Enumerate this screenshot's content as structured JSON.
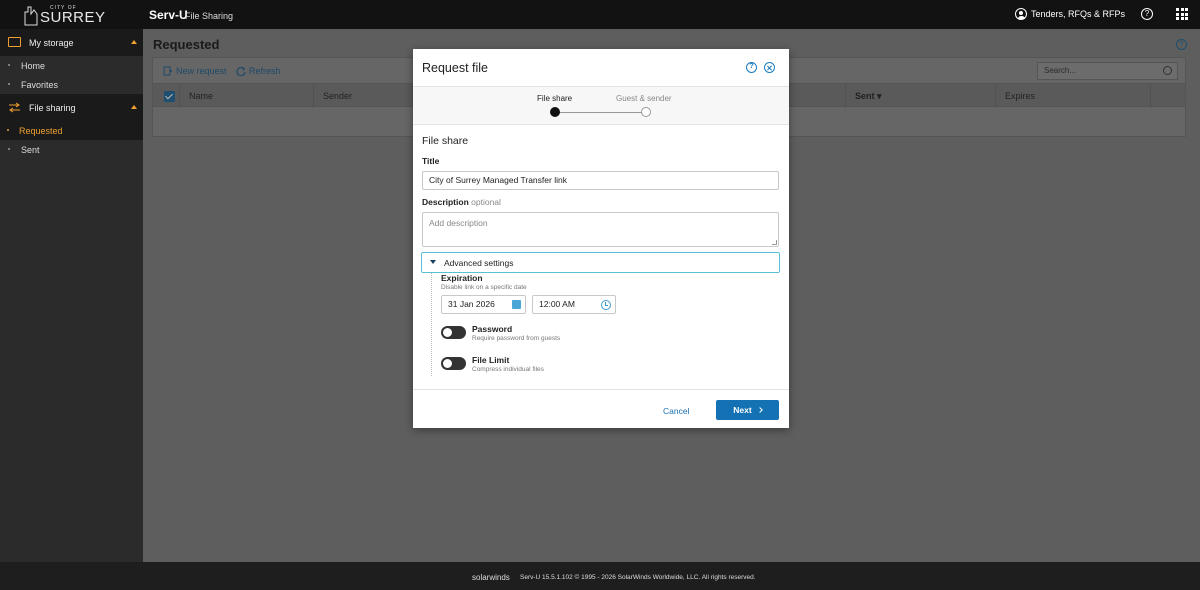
{
  "header": {
    "logo_small": "CITY OF",
    "logo_name": "SURREY",
    "app_title": "Serv-U",
    "app_subtitle": "File Sharing",
    "account_link": "Tenders, RFQs & RFPs"
  },
  "sidebar": {
    "sections": [
      {
        "label": "My storage",
        "items": [
          "Home",
          "Favorites"
        ]
      },
      {
        "label": "File sharing",
        "items": [
          "Requested",
          "Sent"
        ]
      }
    ],
    "active_item": "Requested",
    "accent_color": "#f0a030"
  },
  "main": {
    "title": "Requested",
    "toolbar": {
      "new_request": "New request",
      "refresh": "Refresh"
    },
    "search_placeholder": "Search...",
    "columns": [
      "Name",
      "Sender",
      "Sent",
      "Expires"
    ],
    "sort_indicator": "▾"
  },
  "modal": {
    "title": "Request file",
    "steps": [
      "File share",
      "Guest & sender"
    ],
    "current_step": 1,
    "section_title": "File share",
    "title_label": "Title",
    "title_value": "City of Surrey Managed Transfer link",
    "description_label": "Description",
    "description_optional": "optional",
    "description_placeholder": "Add description",
    "advanced_label": "Advanced settings",
    "expiration": {
      "label": "Expiration",
      "sublabel": "Disable link on a specific date",
      "date": "31 Jan 2026",
      "time": "12:00 AM"
    },
    "password": {
      "label": "Password",
      "sublabel": "Require password from guests",
      "enabled": false
    },
    "file_limit": {
      "label": "File Limit",
      "sublabel": "Compress individual files",
      "enabled": false
    },
    "cancel_label": "Cancel",
    "next_label": "Next",
    "primary_color": "#1471b3"
  },
  "footer": {
    "brand": "solarwinds",
    "copyright": "Serv-U 15.5.1.102 © 1995 - 2026 SolarWinds Worldwide, LLC. All rights reserved."
  }
}
